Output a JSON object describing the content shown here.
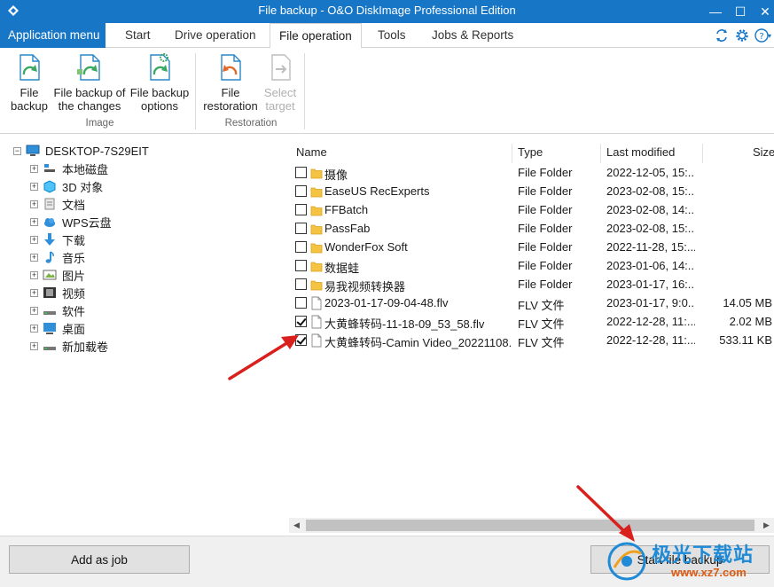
{
  "window": {
    "title": "File backup - O&O DiskImage Professional Edition",
    "minimize_glyph": "—",
    "maximize_glyph": "☐",
    "close_glyph": "✕"
  },
  "tabs": {
    "app_menu": "Application menu",
    "items": [
      "Start",
      "Drive operation",
      "File operation",
      "Tools",
      "Jobs & Reports"
    ],
    "active": "File operation"
  },
  "ribbon": {
    "buttons": [
      {
        "line1": "File",
        "line2": "backup"
      },
      {
        "line1": "File backup of",
        "line2": "the changes"
      },
      {
        "line1": "File backup",
        "line2": "options"
      },
      {
        "line1": "File",
        "line2": "restoration"
      },
      {
        "line1": "Select",
        "line2": "target"
      }
    ],
    "groups": [
      "Image",
      "Restoration"
    ]
  },
  "tree": {
    "root": "DESKTOP-7S29EIT",
    "items": [
      "本地磁盘",
      "3D 对象",
      "文档",
      "WPS云盘",
      "下载",
      "音乐",
      "图片",
      "视频",
      "软件",
      "桌面",
      "新加载卷"
    ]
  },
  "list": {
    "columns": {
      "name": "Name",
      "type": "Type",
      "modified": "Last modified",
      "size": "Size"
    },
    "rows": [
      {
        "name": "摄像",
        "type": "File Folder",
        "modified": "2022-12-05, 15:...",
        "size": "",
        "checked": false,
        "kind": "folder"
      },
      {
        "name": "EaseUS RecExperts",
        "type": "File Folder",
        "modified": "2023-02-08, 15:...",
        "size": "",
        "checked": false,
        "kind": "folder"
      },
      {
        "name": "FFBatch",
        "type": "File Folder",
        "modified": "2023-02-08, 14:...",
        "size": "",
        "checked": false,
        "kind": "folder"
      },
      {
        "name": "PassFab",
        "type": "File Folder",
        "modified": "2023-02-08, 15:...",
        "size": "",
        "checked": false,
        "kind": "folder"
      },
      {
        "name": "WonderFox Soft",
        "type": "File Folder",
        "modified": "2022-11-28, 15:...",
        "size": "",
        "checked": false,
        "kind": "folder"
      },
      {
        "name": "数据蛙",
        "type": "File Folder",
        "modified": "2023-01-06, 14:...",
        "size": "",
        "checked": false,
        "kind": "folder"
      },
      {
        "name": "易我视频转换器",
        "type": "File Folder",
        "modified": "2023-01-17, 16:...",
        "size": "",
        "checked": false,
        "kind": "folder"
      },
      {
        "name": "2023-01-17-09-04-48.flv",
        "type": "FLV 文件",
        "modified": "2023-01-17, 9:0...",
        "size": "14.05 MB",
        "checked": false,
        "kind": "file"
      },
      {
        "name": "大黄蜂转码-11-18-09_53_58.flv",
        "type": "FLV 文件",
        "modified": "2022-12-28, 11:...",
        "size": "2.02 MB",
        "checked": true,
        "kind": "file"
      },
      {
        "name": "大黄蜂转码-Camin Video_20221108...",
        "type": "FLV 文件",
        "modified": "2022-12-28, 11:...",
        "size": "533.11 KB",
        "checked": true,
        "kind": "file"
      }
    ]
  },
  "scrollbar": {
    "left_glyph": "◀",
    "right_glyph": "▶"
  },
  "bottom": {
    "add_job": "Add as job",
    "start_backup": "Start file backup"
  },
  "watermark": {
    "line1": "极光下载站",
    "line2": "www.xz7.com"
  },
  "colors": {
    "accent": "#1777c6",
    "folder": "#f5c342",
    "arrow": "#d9201c"
  }
}
